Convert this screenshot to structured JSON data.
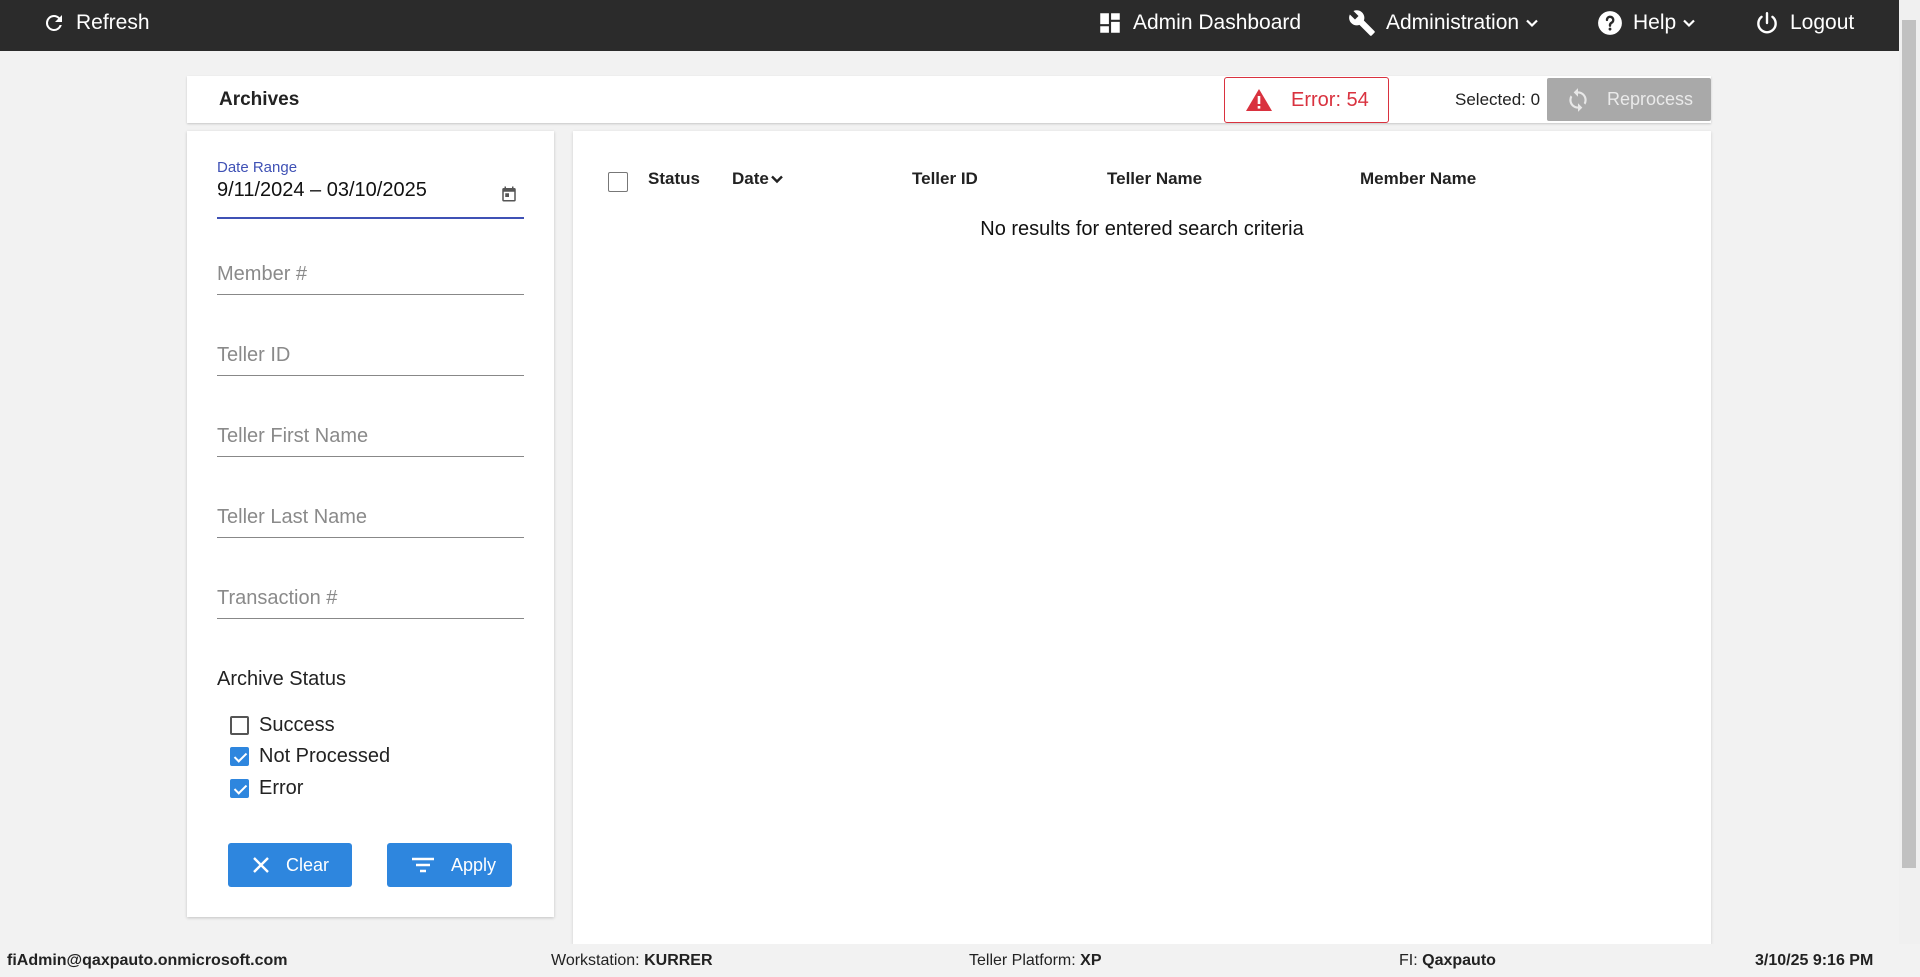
{
  "topbar": {
    "refresh": "Refresh",
    "admin_dashboard": "Admin Dashboard",
    "administration": "Administration",
    "help": "Help",
    "logout": "Logout"
  },
  "header": {
    "title": "Archives",
    "error_badge": "Error: 54",
    "selected": "Selected: 0",
    "reprocess": "Reprocess"
  },
  "filters": {
    "date_range_label": "Date Range",
    "date_range_value": "9/11/2024 – 03/10/2025",
    "member_placeholder": "Member #",
    "teller_id_placeholder": "Teller ID",
    "teller_first_placeholder": "Teller First Name",
    "teller_last_placeholder": "Teller Last Name",
    "transaction_placeholder": "Transaction #",
    "archive_status_title": "Archive Status",
    "statuses": [
      {
        "label": "Success",
        "checked": false
      },
      {
        "label": "Not Processed",
        "checked": true
      },
      {
        "label": "Error",
        "checked": true
      }
    ],
    "clear": "Clear",
    "apply": "Apply"
  },
  "table": {
    "columns": [
      "Status",
      "Date",
      "Teller ID",
      "Teller Name",
      "Member Name"
    ],
    "empty_message": "No results for entered search criteria"
  },
  "footer": {
    "user": "fiAdmin@qaxpauto.onmicrosoft.com",
    "workstation_label": "Workstation:",
    "workstation_value": "KURRER",
    "platform_label": "Teller Platform:",
    "platform_value": "XP",
    "fi_label": "FI:",
    "fi_value": "Qaxpauto",
    "datetime": "3/10/25 9:16 PM"
  },
  "colors": {
    "topbar_bg": "#2b2b2b",
    "accent_blue": "#2e86de",
    "error_red": "#d9323f",
    "focus_indigo": "#3f51b5",
    "disabled_gray": "#a9a9a9"
  }
}
